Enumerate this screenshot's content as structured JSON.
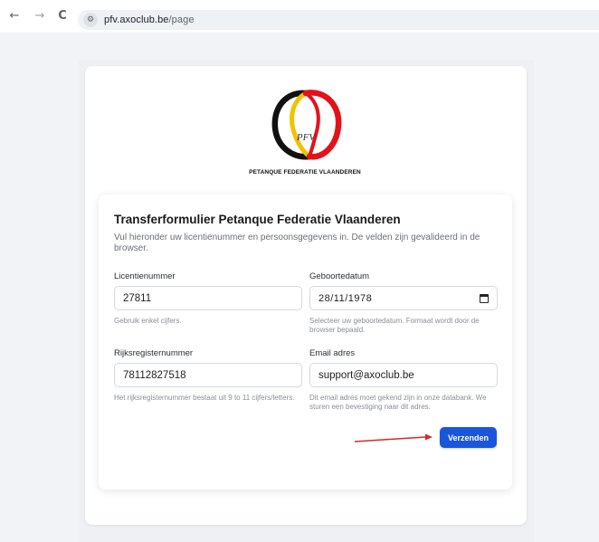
{
  "browser": {
    "back_icon": "←",
    "forward_icon": "→",
    "reload_icon": "C",
    "site_info_icon": "⚙",
    "url_domain": "pfv.axoclub.be",
    "url_path": "/page"
  },
  "logo": {
    "org_name": "PETANQUE FEDERATIE VLAANDEREN",
    "monogram": "PFV",
    "colors": [
      "#111111",
      "#f2c200",
      "#e3121a"
    ]
  },
  "form": {
    "title": "Transferformulier Petanque Federatie Vlaanderen",
    "description": "Vul hieronder uw licentienummer en persoonsgegevens in. De velden zijn gevalideerd in de browser.",
    "license": {
      "label": "Licentienummer",
      "value": "27811",
      "hint": "Gebruik enkel cijfers."
    },
    "birthdate": {
      "label": "Geboortedatum",
      "value": "28/11/1978",
      "hint": "Selecteer uw geboortedatum. Formaat wordt door de browser bepaald."
    },
    "national_id": {
      "label": "Rijksregisternummer",
      "value": "78112827518",
      "hint": "Het rijksregisternummer bestaat uit 9 to 11 cijfers/letters."
    },
    "email": {
      "label": "Email adres",
      "value": "support@axoclub.be",
      "hint": "Dit email adres moet gekend zijn in onze databank. We sturen een bevestiging naar dit adres."
    },
    "submit_label": "Verzenden"
  },
  "accent_color": "#1a56db",
  "annotation_arrow_color": "#d42b2b"
}
